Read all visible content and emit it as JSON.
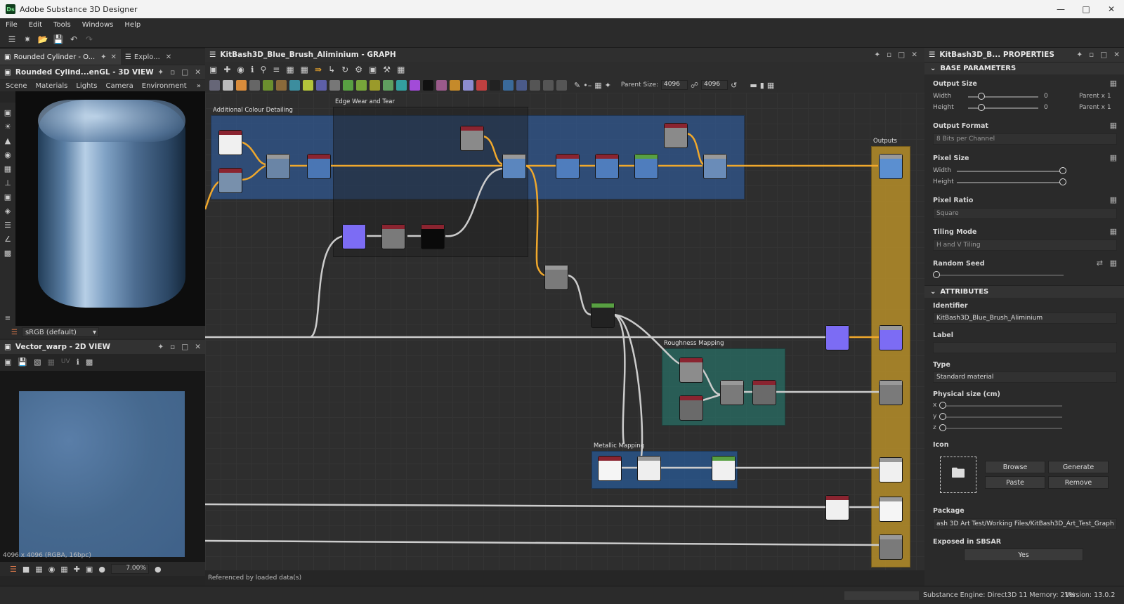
{
  "window": {
    "title": "Adobe Substance 3D Designer",
    "logo": "Ds"
  },
  "menu": [
    "File",
    "Edit",
    "Tools",
    "Windows",
    "Help"
  ],
  "left_tabs": {
    "tab1": "Rounded Cylinder - O...",
    "tab2": "Explo..."
  },
  "view3d": {
    "title": "Rounded Cylind...enGL - 3D VIEW",
    "menu": [
      "Scene",
      "Materials",
      "Lights",
      "Camera",
      "Environment"
    ],
    "colorspace": "sRGB (default)"
  },
  "view2d": {
    "title": "Vector_warp - 2D VIEW",
    "uv_label": "UV",
    "resolution_info": "4096 x 4096 (RGBA, 16bpc)",
    "zoom": "7.00%"
  },
  "graph": {
    "title": "KitBash3D_Blue_Brush_Aliminium - GRAPH",
    "parent_size_label": "Parent Size:",
    "parent_size_a": "4096",
    "parent_size_b": "4096",
    "footer": "Referenced by loaded data(s)",
    "frames": {
      "additional": "Additional Colour Detailing",
      "edge": "Edge Wear and Tear",
      "outputs": "Outputs",
      "roughness": "Roughness Mapping",
      "metallic": "Metallic Mapping"
    }
  },
  "properties": {
    "title": "KitBash3D_B... PROPERTIES",
    "base_section": "BASE PARAMETERS",
    "output_size": {
      "label": "Output Size",
      "width_label": "Width",
      "height_label": "Height",
      "width_value": "0",
      "height_value": "0",
      "width_suffix": "Parent x 1",
      "height_suffix": "Parent x 1"
    },
    "output_format": {
      "label": "Output Format",
      "value": "8 Bits per Channel"
    },
    "pixel_size": {
      "label": "Pixel Size",
      "width_label": "Width",
      "height_label": "Height"
    },
    "pixel_ratio": {
      "label": "Pixel Ratio",
      "value": "Square"
    },
    "tiling_mode": {
      "label": "Tiling Mode",
      "value": "H and V Tiling"
    },
    "random_seed": {
      "label": "Random Seed"
    },
    "attr_section": "ATTRIBUTES",
    "identifier": {
      "label": "Identifier",
      "value": "KitBash3D_Blue_Brush_Aliminium"
    },
    "label": {
      "label": "Label",
      "value": ""
    },
    "type": {
      "label": "Type",
      "value": "Standard material"
    },
    "physical_size": {
      "label": "Physical size (cm)",
      "x": "x",
      "y": "y",
      "z": "z"
    },
    "icon": {
      "label": "Icon",
      "browse": "Browse",
      "generate": "Generate",
      "paste": "Paste",
      "remove": "Remove"
    },
    "package": {
      "label": "Package",
      "value": "ash 3D Art Test/Working Files/KitBash3D_Art_Test_Graph"
    },
    "exposed": {
      "label": "Exposed in SBSAR",
      "value": "Yes"
    }
  },
  "status": {
    "engine": "Substance Engine: Direct3D 11  Memory: 21%",
    "version": "Version: 13.0.2"
  }
}
